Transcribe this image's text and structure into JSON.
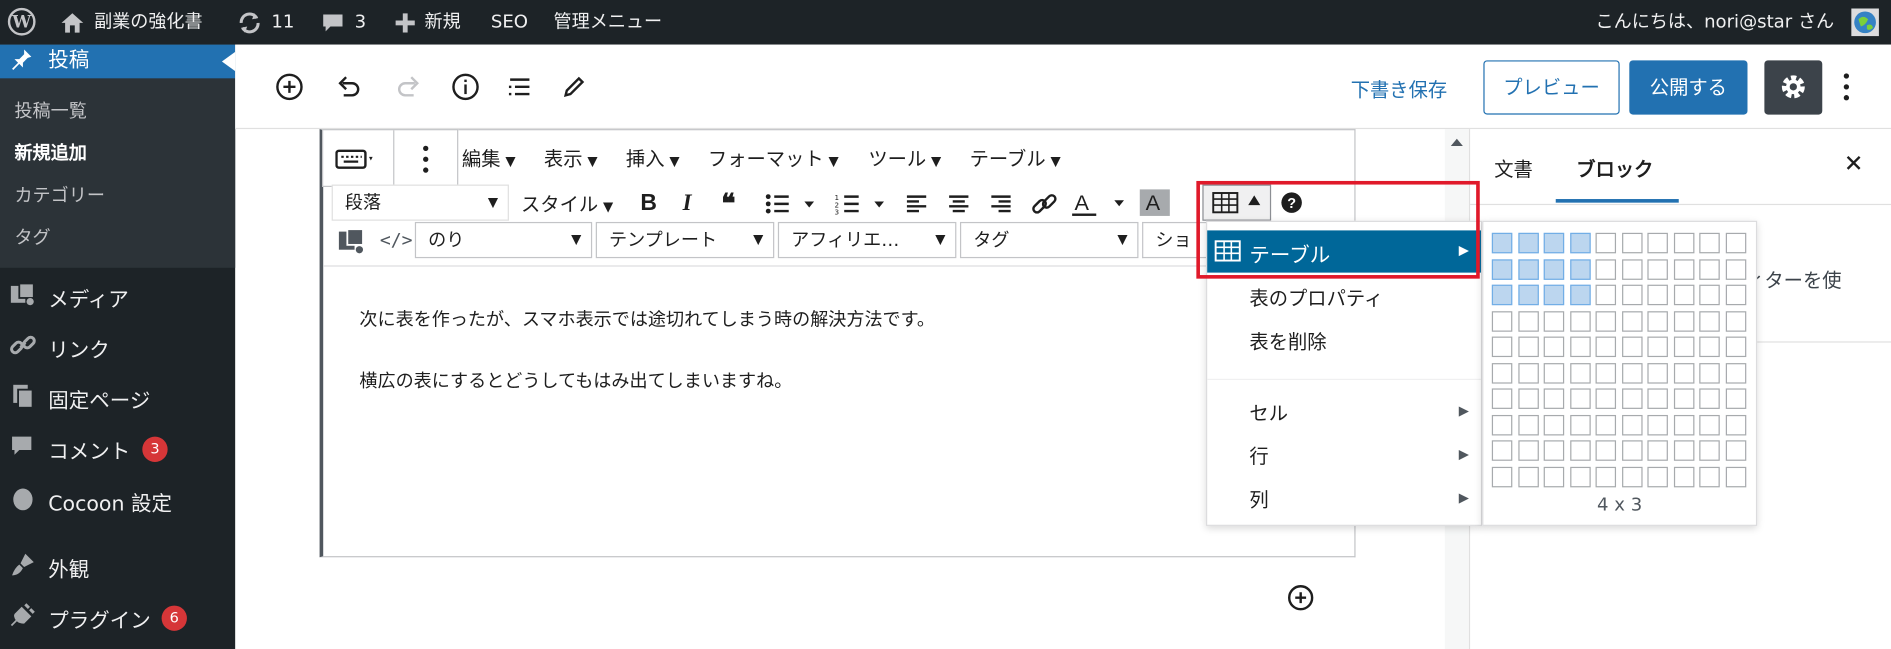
{
  "adminbar": {
    "site_name": "副業の強化書",
    "updates_count": "11",
    "comments_count": "3",
    "new_label": "新規",
    "seo_label": "SEO",
    "manage_label": "管理メニュー",
    "greeting": "こんにちは、nori@star さん"
  },
  "sidebar": {
    "posts": "投稿",
    "sub_items": [
      "投稿一覧",
      "新規追加",
      "カテゴリー",
      "タグ"
    ],
    "media": "メディア",
    "links": "リンク",
    "pages": "固定ページ",
    "comments": "コメント",
    "comments_badge": "3",
    "cocoon": "Cocoon 設定",
    "appearance": "外観",
    "plugins": "プラグイン",
    "plugins_badge": "6"
  },
  "toolbar": {
    "save_draft": "下書き保存",
    "preview": "プレビュー",
    "publish": "公開する"
  },
  "panel": {
    "tab_document": "文書",
    "tab_block": "ブロック",
    "partial_text": "ィターを使"
  },
  "classic_menu": [
    "編集",
    "表示",
    "挿入",
    "フォーマット",
    "ツール",
    "テーブル"
  ],
  "format_select": "段落",
  "style_label": "スタイル",
  "row3": {
    "user_select": "のり",
    "template_select": "テンプレート",
    "affiliate_select": "アフィリエ…",
    "tag_select": "タグ",
    "partial_select": "ショ"
  },
  "content": {
    "para1": "次に表を作ったが、スマホ表示では途切れてしまう時の解決方法です。",
    "para2": "横広の表にするとどうしてもはみ出てしまいますね。"
  },
  "table_menu": {
    "table": "テーブル",
    "properties": "表のプロパティ",
    "delete": "表を削除",
    "cell": "セル",
    "row": "行",
    "column": "列"
  },
  "grid": {
    "label": "4 x 3",
    "selected_cols": 4,
    "selected_rows": 3,
    "total_cols": 10,
    "total_rows": 10
  },
  "colors": {
    "admin_dark": "#1d2327",
    "wp_blue": "#2271b1",
    "highlight_red": "#e0192a",
    "badge_red": "#d63638"
  }
}
